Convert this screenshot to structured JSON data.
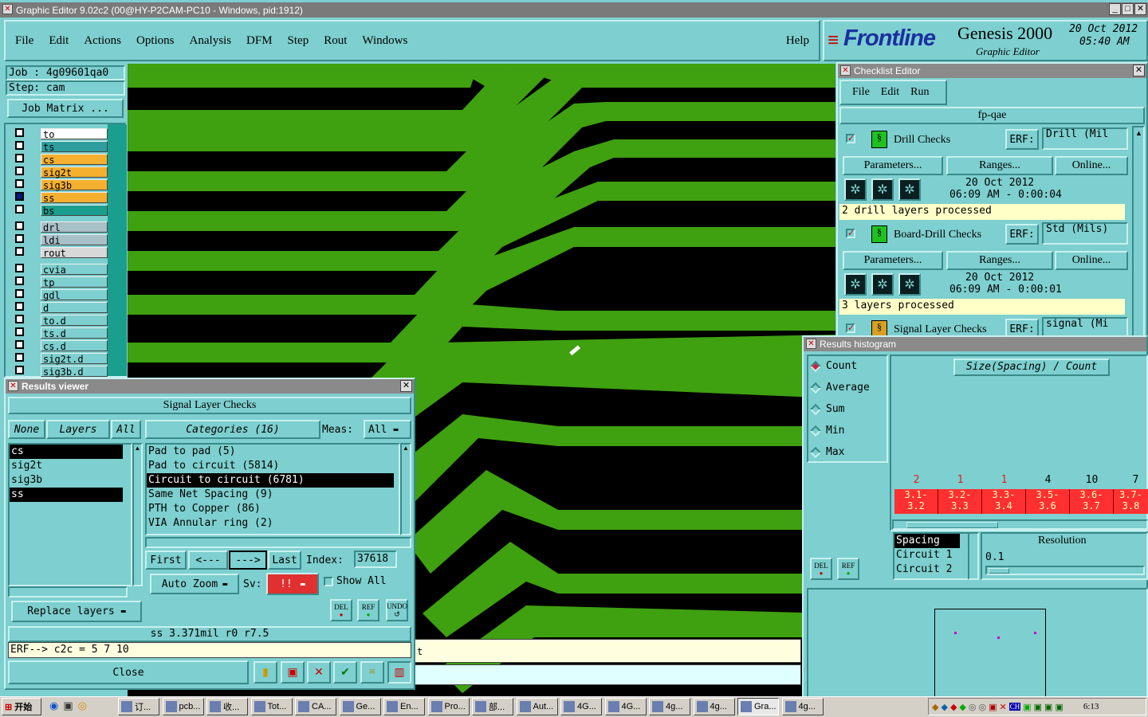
{
  "window": {
    "title": "Graphic Editor 9.02c2 (00@HY-P2CAM-PC10 - Windows, pid:1912)"
  },
  "menu": [
    "File",
    "Edit",
    "Actions",
    "Options",
    "Analysis",
    "DFM",
    "Step",
    "Rout",
    "Windows"
  ],
  "help": "Help",
  "brand": {
    "logo": "Frontline",
    "product": "Genesis 2000",
    "sub": "Graphic Editor",
    "date": "20 Oct 2012",
    "time": "05:40 AM"
  },
  "job": {
    "job": "Job : 4g09601qa0",
    "step": "Step: cam",
    "matrix": "Job Matrix ..."
  },
  "layers": [
    {
      "name": "to",
      "color": "#ffffff"
    },
    {
      "name": "ts",
      "color": "#2e9e9e"
    },
    {
      "name": "cs",
      "color": "#f5b030"
    },
    {
      "name": "sig2t",
      "color": "#f5b030"
    },
    {
      "name": "sig3b",
      "color": "#f5b030"
    },
    {
      "name": "ss",
      "color": "#f5b030"
    },
    {
      "name": "bs",
      "color": "#1a9e8e"
    },
    {
      "name": "drl",
      "color": "#a8c0c8"
    },
    {
      "name": "ldi",
      "color": "#a8c0c8"
    },
    {
      "name": "rout",
      "color": "#d8d8d8"
    },
    {
      "name": "cvia",
      "color": "#7ecfcf"
    },
    {
      "name": "tp",
      "color": "#7ecfcf"
    },
    {
      "name": "gdl",
      "color": "#7ecfcf"
    },
    {
      "name": "d",
      "color": "#7ecfcf"
    },
    {
      "name": "to.d",
      "color": "#7ecfcf"
    },
    {
      "name": "ts.d",
      "color": "#7ecfcf"
    },
    {
      "name": "cs.d",
      "color": "#7ecfcf"
    },
    {
      "name": "sig2t.d",
      "color": "#7ecfcf"
    },
    {
      "name": "sig3b.d",
      "color": "#7ecfcf"
    }
  ],
  "checklist": {
    "title": "Checklist Editor",
    "menu": [
      "File",
      "Edit",
      "Run"
    ],
    "name": "fp-qae",
    "erf": "ERF:",
    "params": "Parameters...",
    "ranges": "Ranges...",
    "online": "Online...",
    "checks": [
      {
        "name": "Drill Checks",
        "erf": "Drill (Mil",
        "date": "20 Oct 2012",
        "time": "06:09 AM - 0:00:04",
        "status": "2 drill layers processed"
      },
      {
        "name": "Board-Drill Checks",
        "erf": "Std (Mils)",
        "date": "20 Oct 2012",
        "time": "06:09 AM - 0:00:01",
        "status": "3 layers processed"
      },
      {
        "name": "Signal Layer Checks",
        "erf": "signal (Mi"
      }
    ]
  },
  "results": {
    "title": "Results viewer",
    "header": "Signal Layer Checks",
    "none": "None",
    "layers": "Layers",
    "all": "All",
    "categories": "Categories (16)",
    "meas_label": "Meas:",
    "meas_value": "All",
    "layer_list": [
      "cs",
      "sig2t",
      "sig3b",
      "ss"
    ],
    "category_list": [
      "Pad to pad (5)",
      "Pad to circuit (5814)",
      "Circuit to circuit (6781)",
      "Same Net Spacing (9)",
      "PTH to Copper (86)",
      "VIA Annular ring (2)"
    ],
    "first": "First",
    "prev": "<---",
    "next": "--->",
    "last": "Last",
    "index_label": "Index:",
    "index_value": "37618",
    "auto_zoom": "Auto Zoom",
    "sv": "Sv:",
    "sv_value": "!!",
    "show_all": "Show All",
    "replace": "Replace layers",
    "del": "DEL",
    "ref": "REF",
    "undo": "UNDO",
    "measure": "ss 3.371mil  r0  r7.5",
    "erf_line": "ERF--> c2c = 5 7 10",
    "close": "Close"
  },
  "histogram": {
    "title": "Results histogram",
    "modes": [
      "Count",
      "Average",
      "Sum",
      "Min",
      "Max"
    ],
    "selected_mode": "Count",
    "chart_title": "Size(Spacing) / Count",
    "bins": [
      {
        "range": "3.1-3.2",
        "count": "2",
        "color": "#e02020"
      },
      {
        "range": "3.2-3.3",
        "count": "1",
        "color": "#e02020"
      },
      {
        "range": "3.3-3.4",
        "count": "1",
        "color": "#e02020"
      },
      {
        "range": "3.5-3.6",
        "count": "4",
        "color": "#000000"
      },
      {
        "range": "3.6-3.7",
        "count": "10",
        "color": "#000000"
      },
      {
        "range": "3.7-3.8",
        "count": "7",
        "color": "#000000"
      }
    ],
    "list": [
      "Spacing",
      "Circuit 1",
      "Circuit 2"
    ],
    "resolution_label": "Resolution",
    "resolution_value": "0.1",
    "del": "DEL",
    "ref": "REF"
  },
  "canvas": {
    "copper": "#3fa010",
    "bg": "#000000",
    "tail": "t"
  },
  "taskbar": {
    "start": "开始",
    "items": [
      "订...",
      "pcb...",
      "收...",
      "Tot...",
      "CA...",
      "Ge...",
      "En...",
      "Pro...",
      "部...",
      "Aut...",
      "4G...",
      "4G...",
      "4g...",
      "4g...",
      "Gra...",
      "4g..."
    ],
    "clock": "6:13"
  }
}
